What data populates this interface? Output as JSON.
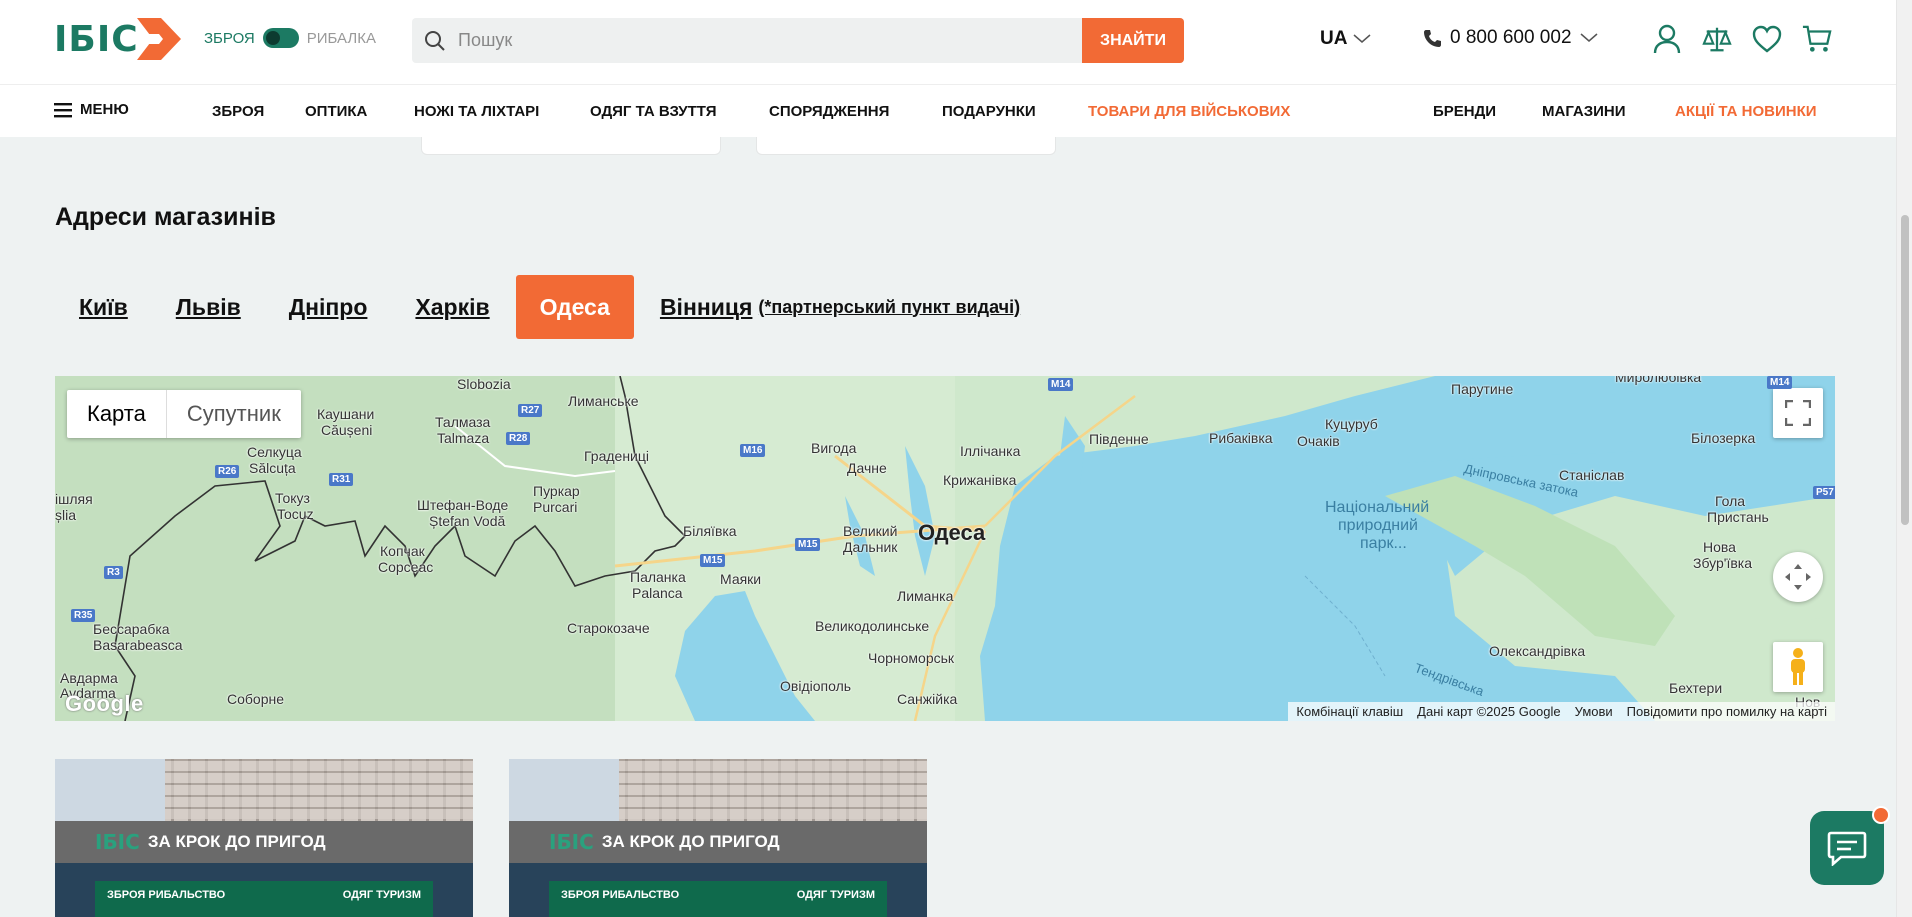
{
  "header": {
    "logo_text": "ІБІС",
    "toggle_left": "ЗБРОЯ",
    "toggle_right": "РИБАЛКА",
    "search_placeholder": "Пошук",
    "search_button": "ЗНАЙТИ",
    "language": "UA",
    "phone": "0 800 600 002"
  },
  "nav": {
    "menu_label": "МЕНЮ",
    "items": [
      "ЗБРОЯ",
      "ОПТИКА",
      "НОЖІ ТА ЛІХТАРІ",
      "ОДЯГ ТА ВЗУТТЯ",
      "СПОРЯДЖЕННЯ",
      "ПОДАРУНКИ",
      "ТОВАРИ ДЛЯ ВІЙСЬКОВИХ"
    ],
    "right_items": [
      "БРЕНДИ",
      "МАГАЗИНИ",
      "АКЦІЇ ТА НОВИНКИ"
    ]
  },
  "stores_section": {
    "title": "Адреси магазинів",
    "tabs": [
      "Київ",
      "Львів",
      "Дніпро",
      "Харків",
      "Одеса",
      "Вінниця"
    ],
    "active_tab": "Одеса",
    "partner_note": "(*партнерський пункт видачі)"
  },
  "map": {
    "type_map": "Карта",
    "type_satellite": "Супутник",
    "main_city": "Одеса",
    "labels": {
      "slobozia": "Slobozia",
      "kaushani": "Каушани",
      "causeni": "Căușeni",
      "talmaza_ua": "Талмаза",
      "talmaza": "Talmaza",
      "lymanske": "Лиманське",
      "selkutsa": "Селкуца",
      "salcuta": "Sălcuța",
      "hradenytsi": "Градениці",
      "vyhoda": "Вигода",
      "dachne": "Дачне",
      "ilichanka": "Іллічанка",
      "kryzhanivka": "Крижанівка",
      "pivdenne": "Південне",
      "rybakivka": "Рибаківка",
      "ochakiv": "Очаків",
      "kutsuruб": "Куцуруб",
      "parutyne": "Парутине",
      "myrolyubivka": "Миролюбівка",
      "bilozerka": "Білозерка",
      "stanislav": "Станіслав",
      "hola_prystan_1": "Гола",
      "hola_prystan_2": "Пристань",
      "nova_zbur_1": "Нова",
      "nova_zbur_2": "Збур'ївка",
      "tokuz": "Токуз",
      "tocuz": "Tocuz",
      "stefan_ua": "Штефан-Воде",
      "stefan": "Ștefan Vodă",
      "purkar": "Пуркар",
      "purcari": "Purcari",
      "biliaivka": "Біляївка",
      "velykyi_1": "Великий",
      "velykyi_2": "Дальник",
      "kopchak": "Копчак",
      "copceac": "Copceac",
      "palanka": "Паланка",
      "palanca": "Palanca",
      "mayaky": "Маяки",
      "lymanka": "Лиманка",
      "starokozache": "Старокозаче",
      "velykodolynske": "Великодолинське",
      "chornomorsk": "Чорноморськ",
      "ovidiopol": "Овідіополь",
      "sanzhiika": "Санжійка",
      "basarabeasca_ua": "Бессарабка",
      "basarabeasca": "Basarabeasca",
      "avdarma_ua": "Авдарма",
      "avdarma": "Avdarma",
      "soborne": "Соборне",
      "mishlia": "ішляя",
      "nishlia2": "șlia",
      "oleksandrivka": "Олександрівка",
      "bekhtery": "Бехтери",
      "nov": "Нов",
      "park_1": "Національний",
      "park_2": "природний",
      "park_3": "парк...",
      "dniprovska": "Дніпровська затока",
      "tendrivska": "Тендрівська"
    },
    "roads": [
      "M14",
      "R27",
      "R28",
      "M16",
      "R26",
      "R31",
      "M15",
      "M15",
      "R3",
      "R35",
      "P57",
      "M14"
    ],
    "footer": [
      "Комбінації клавіш",
      "Дані карт ©2025 Google",
      "Умови",
      "Повідомити про помилку на карті"
    ],
    "google": "Google"
  },
  "store_photo": {
    "logo": "ІБІС",
    "slogan": "ЗА КРОК ДО ПРИГОД",
    "front_left": "ЗБРОЯ РИБАЛЬСТВО",
    "front_right": "ОДЯГ ТУРИЗМ"
  },
  "colors": {
    "brand_green": "#1c7a63",
    "accent_orange": "#f26a35"
  }
}
